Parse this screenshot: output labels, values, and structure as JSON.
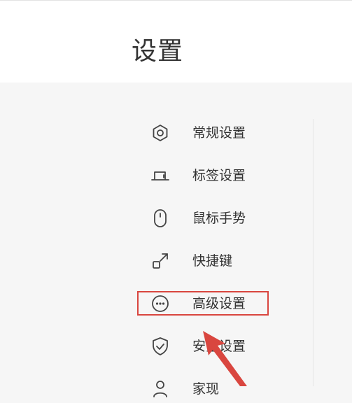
{
  "header": {
    "title": "设置"
  },
  "menu": {
    "items": [
      {
        "label": "常规设置",
        "icon": "hexagon-settings-icon"
      },
      {
        "label": "标签设置",
        "icon": "tab-icon"
      },
      {
        "label": "鼠标手势",
        "icon": "mouse-icon"
      },
      {
        "label": "快捷键",
        "icon": "shortcut-arrow-icon"
      },
      {
        "label": "高级设置",
        "icon": "more-dots-icon",
        "highlighted": true
      },
      {
        "label": "安全设置",
        "icon": "shield-check-icon"
      },
      {
        "label": "家现",
        "icon": "user-icon"
      }
    ]
  },
  "annotation": {
    "highlight_color": "#d9463f",
    "arrow_color": "#d9463f"
  }
}
